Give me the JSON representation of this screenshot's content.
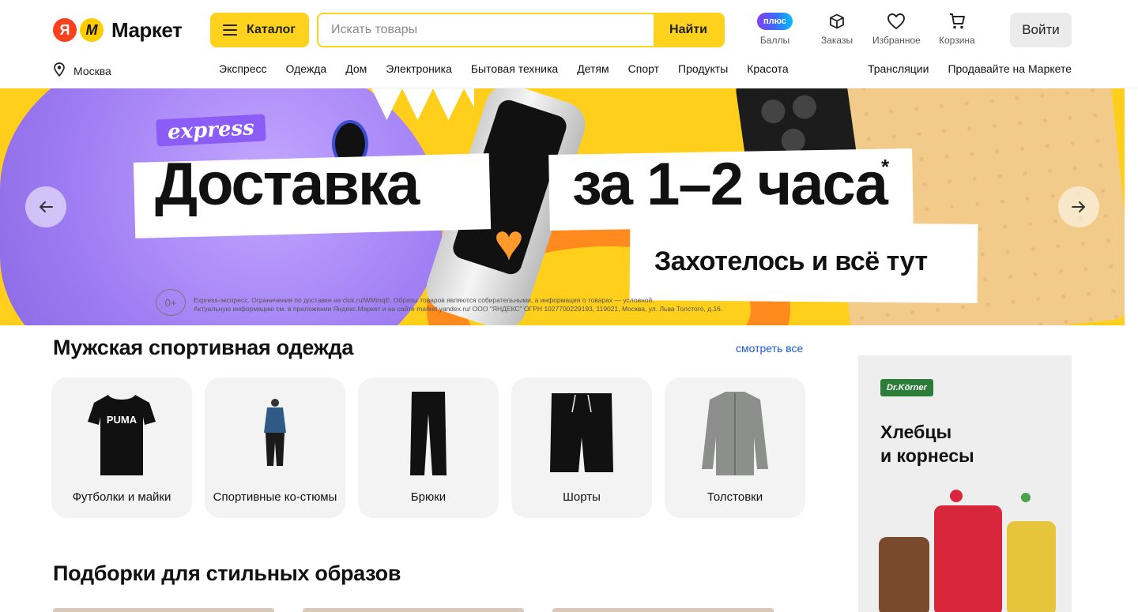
{
  "header": {
    "logo_text": "Маркет",
    "catalog_label": "Каталог",
    "search_placeholder": "Искать товары",
    "search_button": "Найти",
    "plus_badge": "плюс",
    "points_label": "Баллы",
    "orders_label": "Заказы",
    "favorites_label": "Избранное",
    "cart_label": "Корзина",
    "login_label": "Войти",
    "city": "Москва",
    "nav": [
      "Экспресс",
      "Одежда",
      "Дом",
      "Электроника",
      "Бытовая техника",
      "Детям",
      "Спорт",
      "Продукты",
      "Красота"
    ],
    "nav_right": [
      "Трансляции",
      "Продавайте на Маркете"
    ]
  },
  "banner": {
    "tag": "express",
    "headline_left": "Доставка",
    "headline_right": "за 1–2 часа",
    "asterisk": "*",
    "subline": "Захотелось и всё тут",
    "age": "0+",
    "legal_line1": "Express-экспресс. Ограничения по доставке на clck.ru/WMmqE. Образы товаров являются собирательными, а информация о товарах — условной.",
    "legal_line2": "Актуальную информацию см. в приложении Яндекс.Маркет и на сайте market.yandex.ru/ ООО \"ЯНДЕКС\" ОГРН 1027700229193, 119021, Москва, ул. Льва Толстого, д.16.",
    "prev_icon": "arrow-left-icon",
    "next_icon": "arrow-right-icon"
  },
  "section1": {
    "title": "Мужская спортивная одежда",
    "see_all": "смотреть все",
    "cards": [
      {
        "label": "Футболки и майки",
        "icon": "tshirt-icon"
      },
      {
        "label": "Спортивные ко-стюмы",
        "icon": "tracksuit-icon"
      },
      {
        "label": "Брюки",
        "icon": "pants-icon"
      },
      {
        "label": "Шорты",
        "icon": "shorts-icon"
      },
      {
        "label": "Толстовки",
        "icon": "hoodie-icon"
      }
    ]
  },
  "section2": {
    "title": "Подборки для стильных образов"
  },
  "ad": {
    "brand": "Dr.Körner",
    "title_line1": "Хлебцы",
    "title_line2": "и корнесы"
  },
  "colors": {
    "accent_yellow": "#ffd21e",
    "banner_bg": "#ffcf1c",
    "link_blue": "#1a5ad8",
    "logo_red": "#fc3f1d"
  }
}
